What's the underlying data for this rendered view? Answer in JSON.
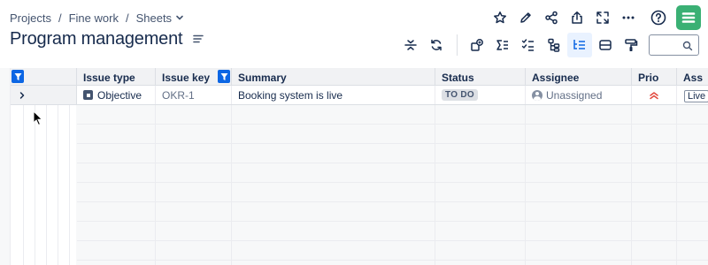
{
  "breadcrumb": {
    "items": [
      "Projects",
      "Fine work",
      "Sheets"
    ],
    "separator": "/"
  },
  "page": {
    "title": "Program management"
  },
  "top_actions": [
    "star-icon",
    "edit-pencil-icon",
    "share-icon",
    "export-icon",
    "fullscreen-icon",
    "more-icon",
    "help-icon",
    "app-logo"
  ],
  "toolbar": {
    "items": [
      "collapse-rows-icon",
      "refresh-icon",
      "add-field-icon",
      "sum-icon",
      "checklist-icon",
      "hierarchy-icon",
      "tree-view-icon",
      "row-height-icon",
      "format-painter-icon"
    ],
    "active": "tree-view-icon",
    "search_placeholder": ""
  },
  "table": {
    "columns": [
      {
        "key": "issue_type",
        "label": "Issue type"
      },
      {
        "key": "issue_key",
        "label": "Issue key",
        "filtered": true
      },
      {
        "key": "summary",
        "label": "Summary"
      },
      {
        "key": "status",
        "label": "Status"
      },
      {
        "key": "assignee",
        "label": "Assignee"
      },
      {
        "key": "priority",
        "label": "Prio"
      },
      {
        "key": "extra",
        "label": "Ass"
      }
    ],
    "rows": [
      {
        "issue_type": "Objective",
        "issue_key": "OKR-1",
        "summary": "Booking system is live",
        "status": "TO DO",
        "assignee": "Unassigned",
        "priority": "highest-priority-icon",
        "extra": "Live"
      }
    ]
  },
  "colors": {
    "accent": "#0c66e4",
    "logo": "#3ab074",
    "priority": "#e2483d",
    "status_bg": "#dcdfe4"
  }
}
